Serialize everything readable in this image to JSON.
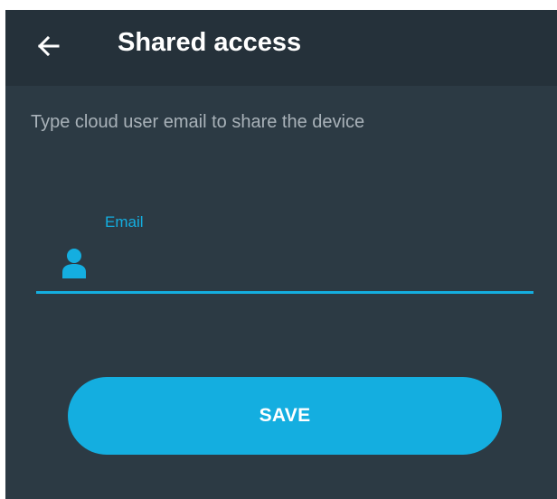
{
  "app_bar": {
    "title": "Shared access",
    "back_icon": "arrow-left-icon"
  },
  "main": {
    "hint": "Type cloud user email to share the device",
    "email_field": {
      "label": "Email",
      "value": "",
      "icon": "user-icon"
    },
    "save_label": "SAVE"
  },
  "colors": {
    "accent": "#14aee0",
    "background": "#2c3a44",
    "app_bar": "#25313a",
    "hint_text": "#a9b2b9"
  }
}
